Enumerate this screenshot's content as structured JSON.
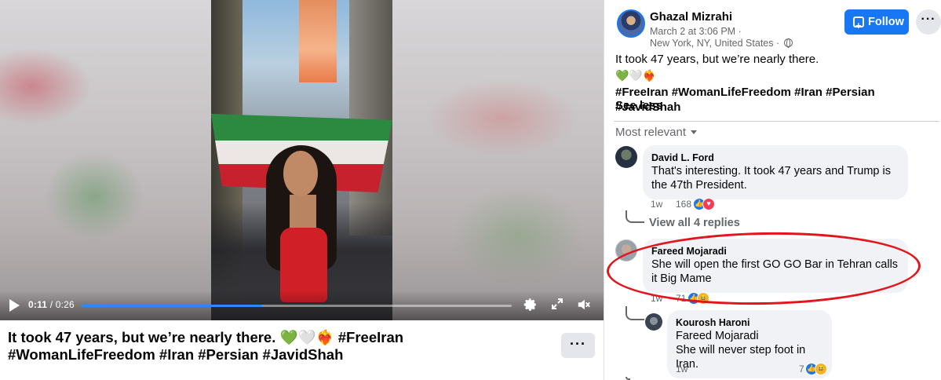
{
  "video": {
    "current_time": "0:11",
    "duration": "/ 0:26",
    "progress_fraction": 0.42,
    "caption": "It took 47 years, but we’re nearly there. 💚🤍❤️‍🔥 #FreeIran #WomanLifeFreedom #Iran #Persian #JavidShah",
    "more_label": "···",
    "icons": {
      "play": "play-icon",
      "settings": "gear-icon",
      "fullscreen": "fullscreen-icon",
      "volume": "volume-muted-icon"
    }
  },
  "post": {
    "author": "Ghazal Mizrahi",
    "date": "March 2 at 3:06 PM ·",
    "location": "New York, NY, United States ·",
    "follow_label": "Follow",
    "menu_label": "···",
    "text": "It took 47 years, but we’re nearly there.",
    "emoji": "💚🤍❤️‍🔥",
    "hashtags": "#FreeIran #WomanLifeFreedom #Iran #Persian #JavidShah",
    "see_less": "See less",
    "sort_label": "Most relevant"
  },
  "comments": [
    {
      "name": "David L. Ford",
      "text": "That's interesting. It took 47 years and Trump is the 47th President.",
      "time": "1w",
      "reactions_count": "168",
      "reactions": [
        "like",
        "love"
      ]
    },
    {
      "name": "Fareed Mojaradi",
      "text": "She will open the first GO GO Bar in Tehran calls it Big Mame",
      "time": "1w",
      "reactions_count": "71",
      "reactions": [
        "like",
        "haha"
      ]
    }
  ],
  "view_replies": "View all 4 replies",
  "reply": {
    "name": "Kourosh Haroni",
    "mention": "Fareed Mojaradi",
    "text": "She will never step foot in Iran.",
    "time": "1w",
    "reactions_count": "7",
    "reactions": [
      "like",
      "haha"
    ]
  },
  "colors": {
    "accent": "#1877f2",
    "annotation": "#e3141b",
    "secondary_text": "#65676b",
    "bubble": "#f0f2f5"
  }
}
